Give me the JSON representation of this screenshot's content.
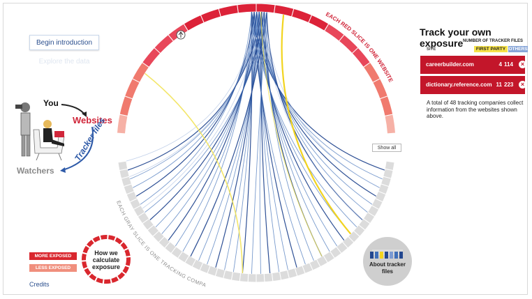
{
  "intro": {
    "begin_label": "Begin introduction",
    "faded_label": "Explore the data"
  },
  "illustration": {
    "you": "You",
    "websites": "Websites",
    "tracker_files": "Tracker files",
    "watchers": "Watchers"
  },
  "wheel": {
    "top_caption": "EACH RED SLICE IS ONE WEBSITE",
    "bottom_caption": "EACH GRAY SLICE IS ONE TRACKING COMPANY",
    "show_all": "Show all",
    "about_label": "About tracker files"
  },
  "legend": {
    "more": "MORE EXPOSED",
    "less": "LESS EXPOSED",
    "calc_label": "How we calculate exposure",
    "credits": "Credits"
  },
  "panel": {
    "title": "Track your own exposure",
    "number_label": "NUMBER OF TRACKER FILES",
    "col_site": "SITE",
    "first_party": "FIRST PARTY",
    "others": "OTHERS",
    "rows": [
      {
        "site": "careerbuilder.com",
        "first": "4",
        "others": "114"
      },
      {
        "site": "dictionary.reference.com",
        "first": "11",
        "others": "223"
      }
    ],
    "note": "A total of 48 tracking companies collect information from the websites shown above."
  },
  "colors": {
    "red_dark": "#c3162a",
    "red_light": "#f08f7d",
    "gray_ring": "#dcdcdc",
    "blue_line": "#3f6fb8",
    "yellow_line": "#f2e35a"
  }
}
